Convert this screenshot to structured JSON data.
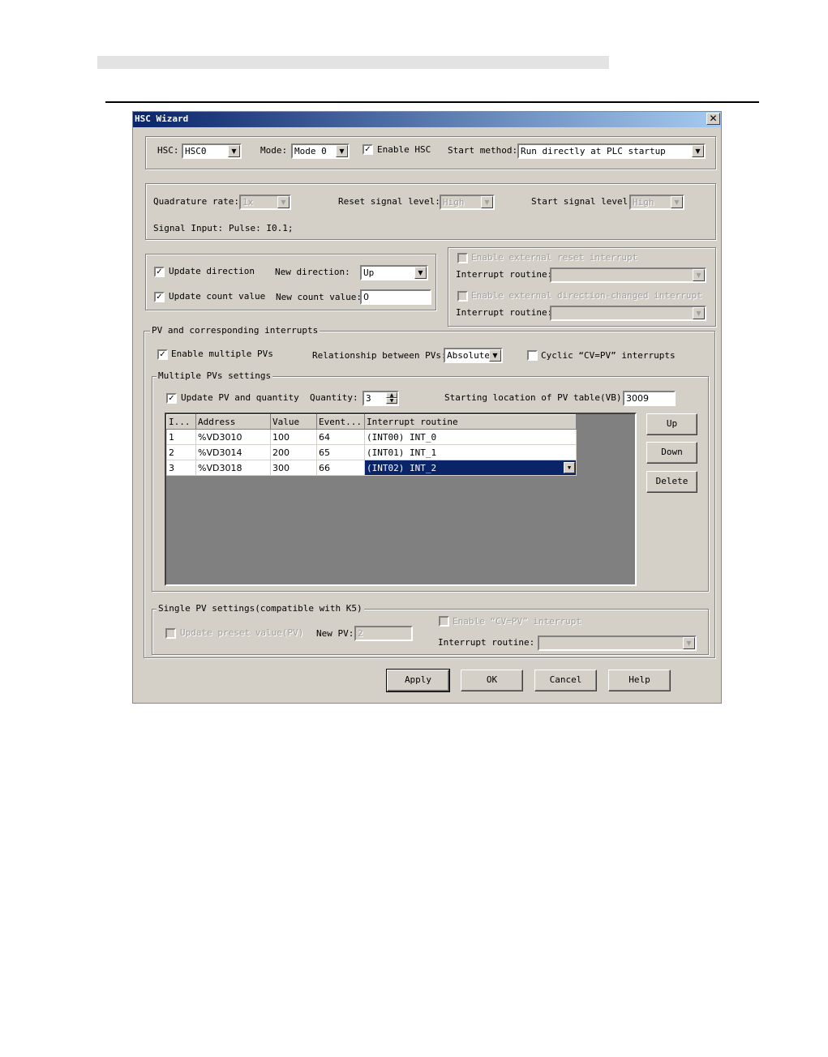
{
  "window": {
    "title": "HSC Wizard",
    "close_glyph": "✕"
  },
  "top": {
    "hsc_label": "HSC:",
    "hsc_value": "HSC0",
    "mode_label": "Mode:",
    "mode_value": "Mode 0",
    "enable_hsc_label": "Enable HSC",
    "enable_hsc_checked": true,
    "start_method_label": "Start method:",
    "start_method_value": "Run directly at PLC startup"
  },
  "signal": {
    "quad_label": "Quadrature rate:",
    "quad_value": "1x",
    "reset_label": "Reset signal level:",
    "reset_value": "High",
    "start_label": "Start signal level:",
    "start_value": "High",
    "input_label": "Signal Input:",
    "input_value": "Pulse: I0.1;"
  },
  "direction": {
    "update_dir_label": "Update direction",
    "update_dir_checked": true,
    "new_dir_label": "New direction:",
    "new_dir_value": "Up",
    "update_count_label": "Update count value",
    "update_count_checked": true,
    "new_count_label": "New count value:",
    "new_count_value": "0"
  },
  "external": {
    "reset_int_label": "Enable external reset interrupt",
    "routine1_label": "Interrupt routine:",
    "dir_int_label": "Enable external direction-changed interrupt",
    "routine2_label": "Interrupt routine:"
  },
  "pv": {
    "legend": "PV and corresponding interrupts",
    "enable_multi_label": "Enable multiple PVs",
    "enable_multi_checked": true,
    "relationship_label": "Relationship between PVs:",
    "relationship_value": "Absolute",
    "cyclic_label": "Cyclic “CV=PV” interrupts",
    "cyclic_checked": false,
    "multi_legend": "Multiple PVs settings",
    "update_pv_label": "Update PV and quantity",
    "update_pv_checked": true,
    "quantity_label": "Quantity:",
    "quantity_value": "3",
    "start_loc_label": "Starting location of PV table(VB):",
    "start_loc_value": "3009",
    "columns": [
      "I...",
      "Address",
      "Value",
      "Event...",
      "Interrupt routine"
    ],
    "rows": [
      {
        "index": "1",
        "address": "%VD3010",
        "value": "100",
        "event": "64",
        "routine": "(INT00)  INT_0"
      },
      {
        "index": "2",
        "address": "%VD3014",
        "value": "200",
        "event": "65",
        "routine": "(INT01)  INT_1"
      },
      {
        "index": "3",
        "address": "%VD3018",
        "value": "300",
        "event": "66",
        "routine": "(INT02)  INT_2"
      }
    ],
    "up_label": "Up",
    "down_label": "Down",
    "delete_label": "Delete"
  },
  "single": {
    "legend": "Single PV settings(compatible with K5)",
    "update_preset_label": "Update preset value(PV)",
    "new_pv_label": "New PV:",
    "new_pv_value": "2",
    "enable_cv_label": "Enable “CV=PV” interrupt",
    "routine_label": "Interrupt routine:"
  },
  "footer": {
    "apply": "Apply",
    "ok": "OK",
    "cancel": "Cancel",
    "help": "Help"
  },
  "glyphs": {
    "check": "✓",
    "arrow_down": "▼",
    "arrow_up": "▲"
  }
}
